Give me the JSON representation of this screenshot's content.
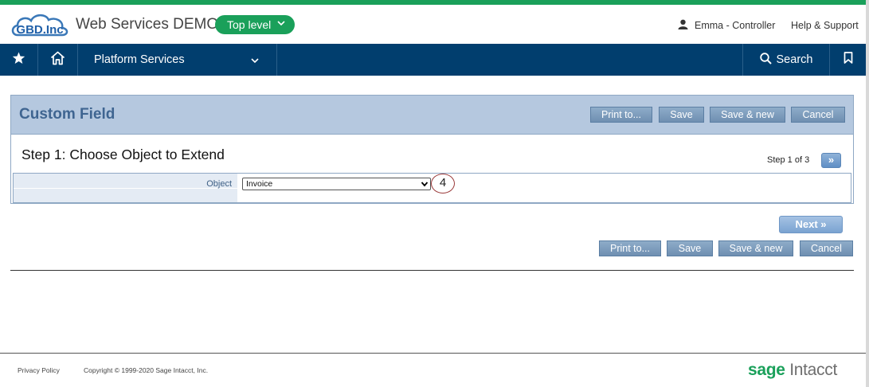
{
  "header": {
    "logo_text": "GBD.Inc",
    "app_title": "Web Services DEMO",
    "level_button": "Top level",
    "user_label": "Emma - Controller",
    "help_label": "Help & Support"
  },
  "navbar": {
    "platform_label": "Platform Services",
    "search_label": "Search"
  },
  "panel": {
    "title": "Custom Field",
    "buttons": {
      "print": "Print to...",
      "save": "Save",
      "save_new": "Save & new",
      "cancel": "Cancel"
    },
    "step_title": "Step 1: Choose Object to Extend",
    "step_counter": "Step 1 of 3",
    "step_next_glyph": "»",
    "field_label": "Object",
    "field_value": "Invoice",
    "badge": "4"
  },
  "bottom": {
    "next_label": "Next »",
    "buttons": {
      "print": "Print to...",
      "save": "Save",
      "save_new": "Save & new",
      "cancel": "Cancel"
    }
  },
  "footer": {
    "privacy": "Privacy Policy",
    "copyright": "Copyright © 1999-2020 Sage Intacct, Inc.",
    "brand_sage": "sage",
    "brand_intacct": "Intacct"
  },
  "colors": {
    "accent_green": "#1aa05a",
    "nav_blue": "#013e6e",
    "panel_header": "#b5c8df",
    "title_blue": "#3f6591"
  },
  "icons": [
    "cloud-logo",
    "user-icon",
    "star-icon",
    "home-icon",
    "chevron-down-icon",
    "search-icon",
    "bookmark-icon"
  ]
}
